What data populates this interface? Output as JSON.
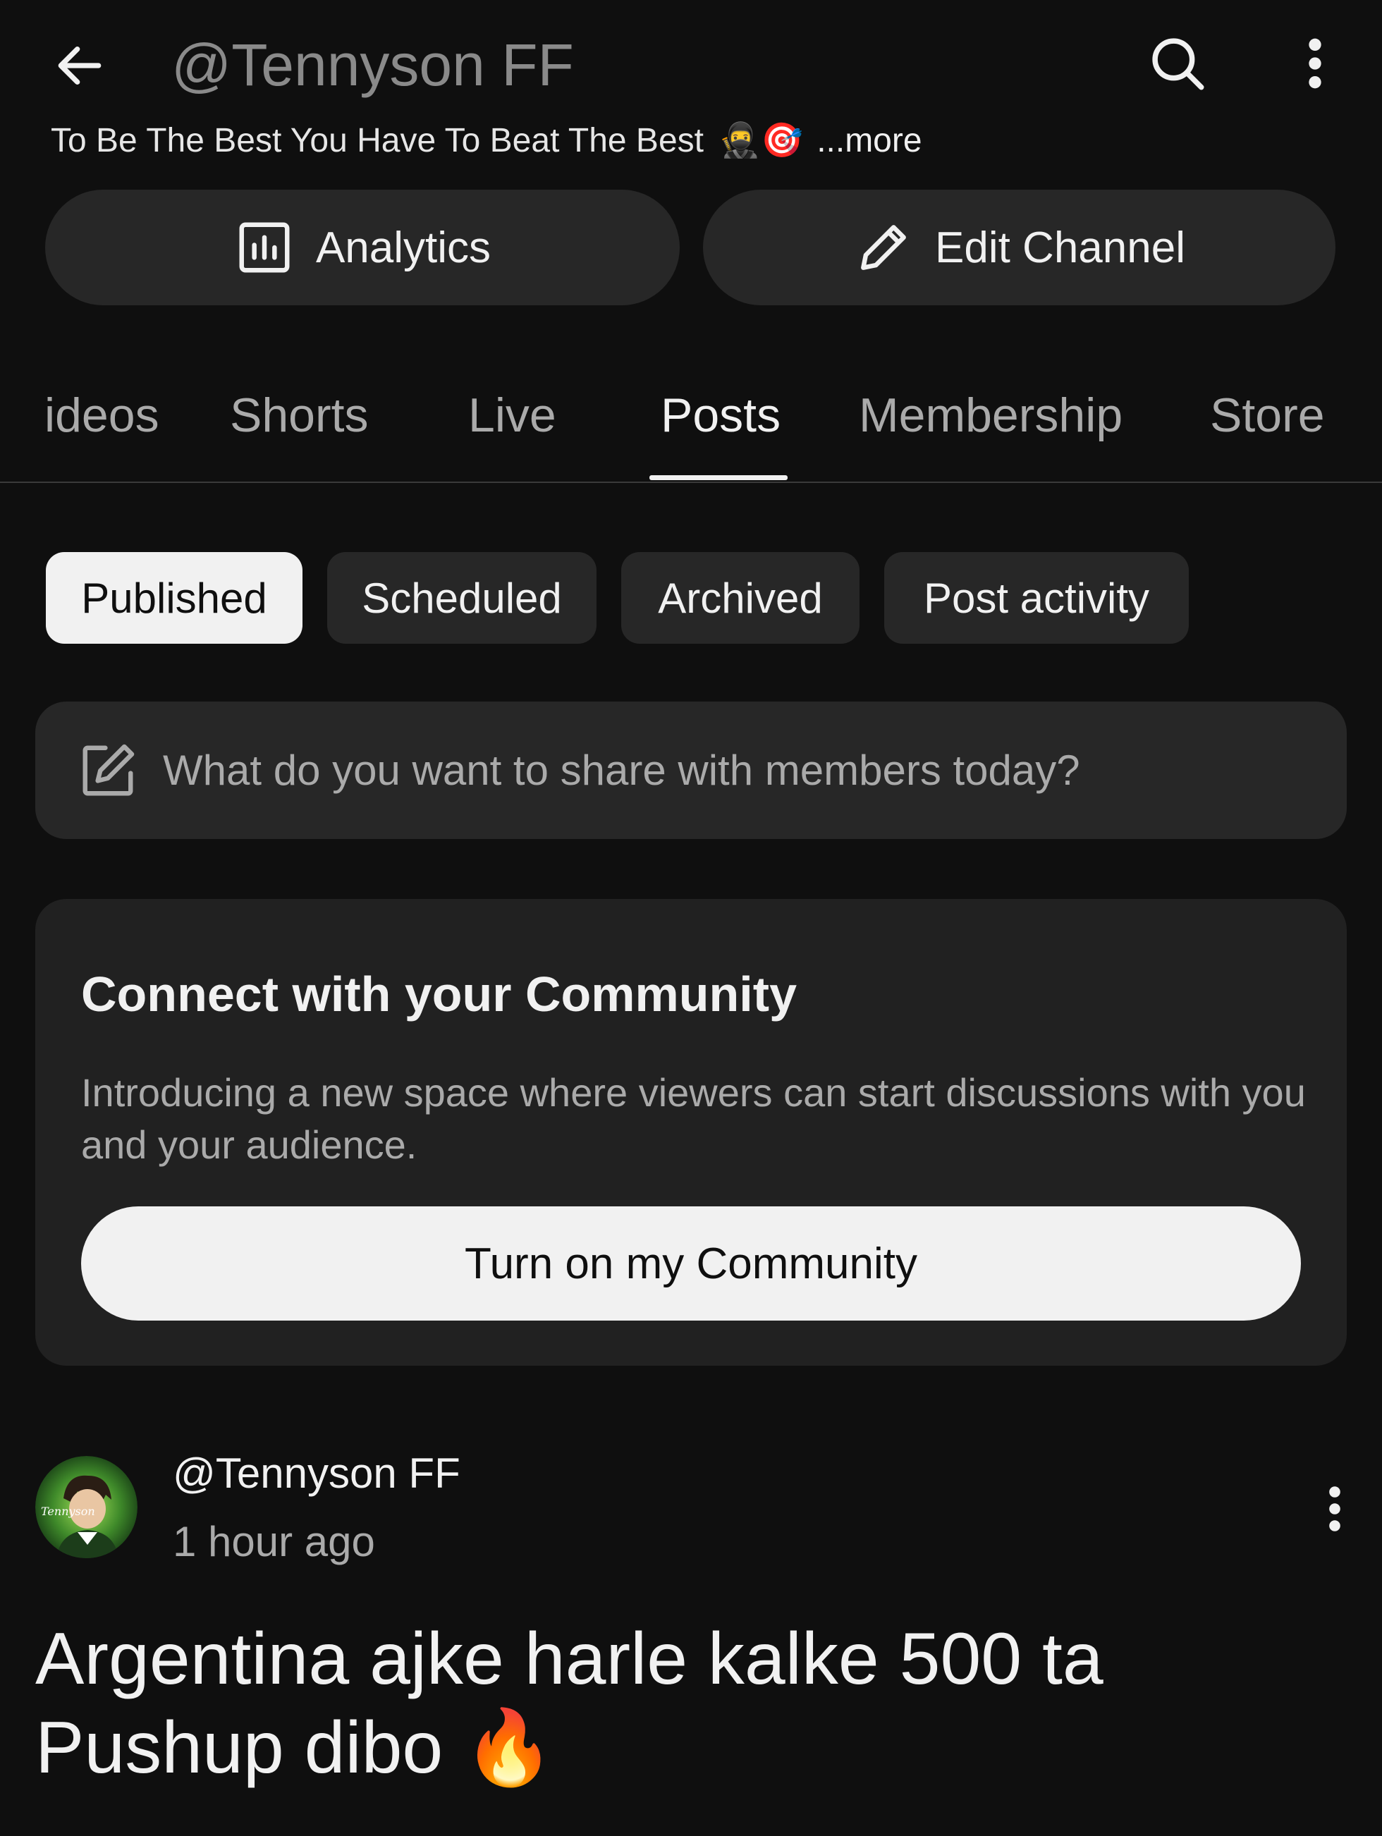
{
  "header": {
    "title": "@Tennyson FF",
    "back_icon": "arrow-left-icon",
    "search_icon": "search-icon",
    "more_icon": "more-vertical-icon"
  },
  "channel": {
    "tagline": "To Be The Best You Have To Beat The Best",
    "tagline_emojis": "🥷🎯",
    "more_label": "...more"
  },
  "actions": {
    "analytics_label": "Analytics",
    "edit_label": "Edit Channel"
  },
  "tabs": [
    {
      "label": "ideos"
    },
    {
      "label": "Shorts"
    },
    {
      "label": "Live"
    },
    {
      "label": "Posts",
      "active": true
    },
    {
      "label": "Membership"
    },
    {
      "label": "Store"
    }
  ],
  "filters": [
    {
      "label": "Published",
      "active": true
    },
    {
      "label": "Scheduled"
    },
    {
      "label": "Archived"
    },
    {
      "label": "Post activity"
    }
  ],
  "composer": {
    "placeholder": "What do you want to share with members today?",
    "icon": "edit-square-icon"
  },
  "community_card": {
    "title": "Connect with your Community",
    "description": "Introducing a new space where viewers can start discussions with you and your audience.",
    "button_label": "Turn on my Community"
  },
  "post": {
    "author": "@Tennyson FF",
    "time": "1 hour ago",
    "avatar_text": "Tennyson",
    "body": "Argentina ajke harle kalke 500 ta Pushup dibo",
    "body_emoji": "🔥"
  },
  "colors": {
    "background": "#0f0f0f",
    "surface": "#272727",
    "card": "#212121",
    "text_primary": "#f1f1f1",
    "text_secondary": "#aaaaaa"
  }
}
